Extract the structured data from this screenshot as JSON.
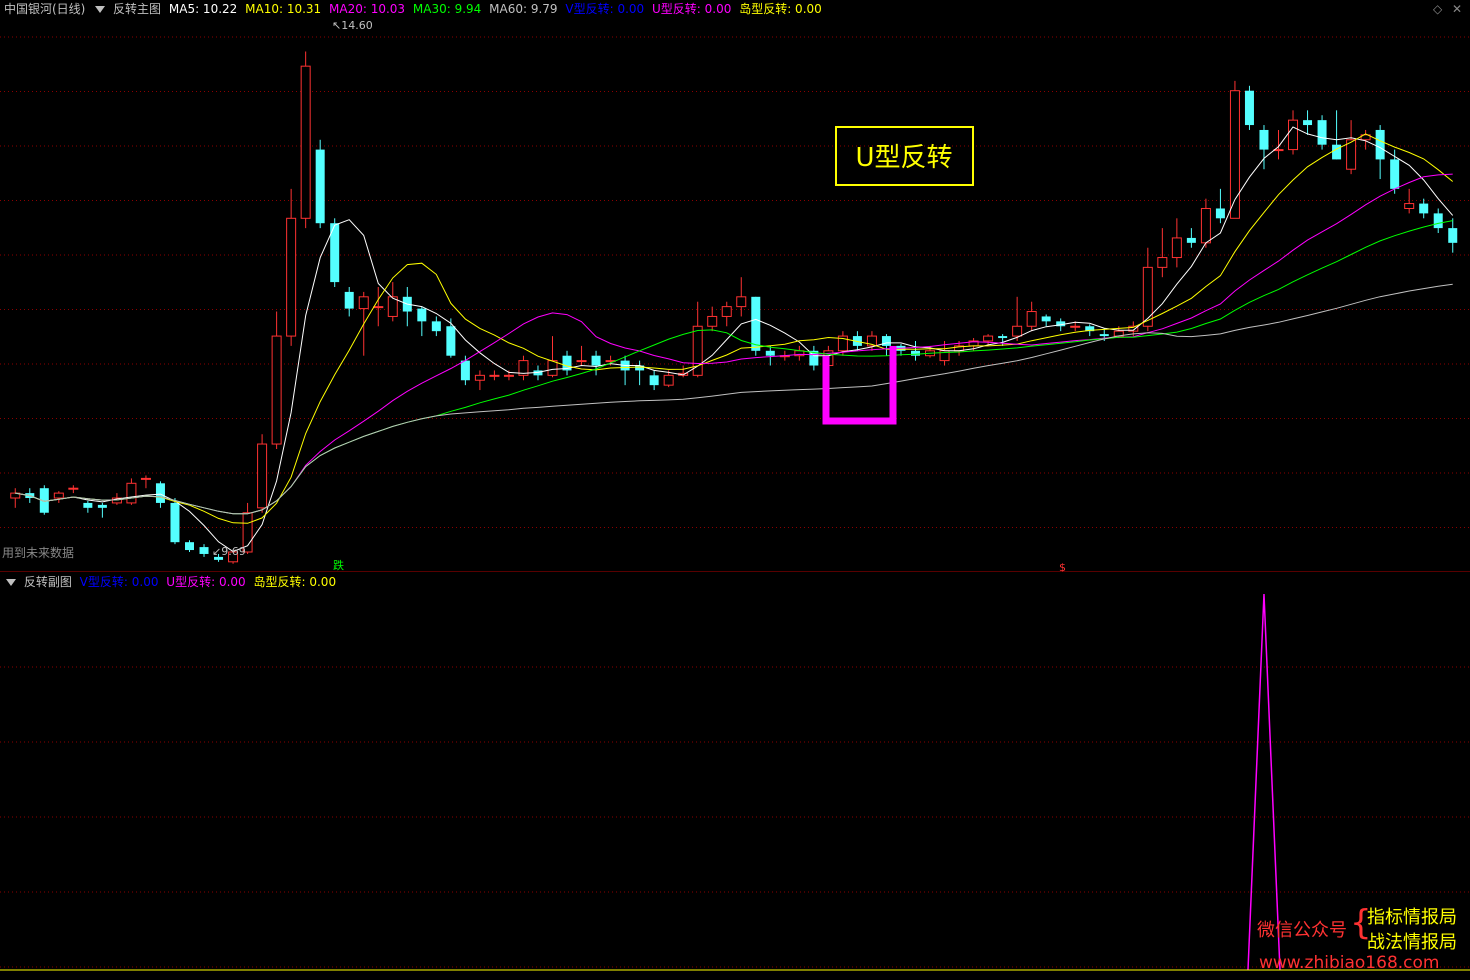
{
  "header": {
    "stock": "中国银河(日线)",
    "indicator": "反转主图",
    "ma": [
      {
        "label": "MA5: 10.22",
        "color": "#ffffff"
      },
      {
        "label": "MA10: 10.31",
        "color": "#ffff00"
      },
      {
        "label": "MA20: 10.03",
        "color": "#ff00ff"
      },
      {
        "label": "MA30: 9.94",
        "color": "#00ff00"
      },
      {
        "label": "MA60: 9.79",
        "color": "#c0c0c0"
      },
      {
        "label": "V型反转: 0.00",
        "color": "#0000ff"
      },
      {
        "label": "U型反转: 0.00",
        "color": "#ff00ff"
      },
      {
        "label": "岛型反转: 0.00",
        "color": "#ffff00"
      }
    ]
  },
  "sub_header": {
    "indicator": "反转副图",
    "items": [
      {
        "label": "V型反转: 0.00",
        "color": "#0000ff"
      },
      {
        "label": "U型反转: 0.00",
        "color": "#ff00ff"
      },
      {
        "label": "岛型反转: 0.00",
        "color": "#ffff00"
      }
    ]
  },
  "labels": {
    "future_data": "用到未来数据",
    "high_price": "14.60",
    "low_price": "9.69",
    "u_box": "U型反转",
    "die": "跌",
    "dollar": "$"
  },
  "watermark": {
    "wechat": "微信公众号",
    "name1": "指标情报局",
    "name2": "战法情报局",
    "url": "www.zhibiao168.com"
  },
  "colors": {
    "up": "#ff3232",
    "down": "#54ffff",
    "ma5": "#ffffff",
    "ma10": "#ffff00",
    "ma20": "#ff00ff",
    "ma30": "#00ff00",
    "ma60": "#c0c0c0",
    "u_mark": "#ff00ff",
    "grid": "#8b0000"
  },
  "chart_data": {
    "type": "candlestick",
    "ylim": [
      9.5,
      14.9
    ],
    "candles": [
      [
        10.05,
        10.1,
        9.95,
        10.15
      ],
      [
        10.1,
        10.05,
        10.0,
        10.15
      ],
      [
        10.15,
        9.9,
        9.88,
        10.18
      ],
      [
        10.05,
        10.1,
        10.0,
        10.12
      ],
      [
        10.15,
        10.15,
        10.1,
        10.18
      ],
      [
        10.0,
        9.95,
        9.9,
        10.02
      ],
      [
        9.98,
        9.95,
        9.85,
        10.0
      ],
      [
        10.0,
        10.05,
        9.98,
        10.1
      ],
      [
        10.0,
        10.2,
        9.98,
        10.25
      ],
      [
        10.25,
        10.25,
        10.15,
        10.28
      ],
      [
        10.2,
        10.0,
        9.95,
        10.22
      ],
      [
        10.0,
        9.6,
        9.58,
        10.05
      ],
      [
        9.6,
        9.52,
        9.5,
        9.62
      ],
      [
        9.55,
        9.48,
        9.45,
        9.58
      ],
      [
        9.45,
        9.42,
        9.4,
        9.48
      ],
      [
        9.4,
        9.5,
        9.38,
        9.52
      ],
      [
        9.5,
        9.9,
        9.48,
        10.0
      ],
      [
        9.95,
        10.6,
        9.9,
        10.7
      ],
      [
        10.6,
        11.7,
        10.55,
        11.95
      ],
      [
        11.7,
        12.9,
        11.6,
        13.2
      ],
      [
        12.9,
        14.45,
        12.8,
        14.6
      ],
      [
        13.6,
        12.85,
        12.8,
        13.7
      ],
      [
        12.85,
        12.25,
        12.2,
        12.9
      ],
      [
        12.15,
        11.98,
        11.9,
        12.2
      ],
      [
        11.98,
        12.1,
        11.5,
        12.15
      ],
      [
        12.0,
        12.0,
        11.8,
        12.2
      ],
      [
        11.9,
        12.1,
        11.85,
        12.25
      ],
      [
        12.1,
        11.95,
        11.8,
        12.2
      ],
      [
        11.98,
        11.85,
        11.7,
        12.0
      ],
      [
        11.85,
        11.75,
        11.7,
        11.9
      ],
      [
        11.8,
        11.5,
        11.48,
        11.88
      ],
      [
        11.45,
        11.25,
        11.2,
        11.5
      ],
      [
        11.25,
        11.3,
        11.15,
        11.35
      ],
      [
        11.3,
        11.3,
        11.25,
        11.35
      ],
      [
        11.3,
        11.3,
        11.25,
        11.35
      ],
      [
        11.3,
        11.45,
        11.25,
        11.5
      ],
      [
        11.35,
        11.3,
        11.25,
        11.4
      ],
      [
        11.3,
        11.45,
        11.28,
        11.7
      ],
      [
        11.5,
        11.35,
        11.3,
        11.55
      ],
      [
        11.45,
        11.45,
        11.4,
        11.6
      ],
      [
        11.5,
        11.4,
        11.3,
        11.55
      ],
      [
        11.45,
        11.45,
        11.4,
        11.5
      ],
      [
        11.45,
        11.35,
        11.2,
        11.5
      ],
      [
        11.4,
        11.35,
        11.2,
        11.45
      ],
      [
        11.3,
        11.2,
        11.15,
        11.35
      ],
      [
        11.2,
        11.3,
        11.18,
        11.35
      ],
      [
        11.3,
        11.32,
        11.28,
        11.4
      ],
      [
        11.3,
        11.8,
        11.28,
        12.05
      ],
      [
        11.8,
        11.9,
        11.75,
        12.0
      ],
      [
        11.9,
        12.0,
        11.8,
        12.05
      ],
      [
        12.0,
        12.1,
        11.9,
        12.3
      ],
      [
        12.1,
        11.55,
        11.5,
        12.1
      ],
      [
        11.55,
        11.5,
        11.4,
        11.6
      ],
      [
        11.5,
        11.5,
        11.45,
        11.55
      ],
      [
        11.5,
        11.55,
        11.45,
        11.6
      ],
      [
        11.55,
        11.4,
        11.35,
        11.6
      ],
      [
        11.4,
        11.55,
        11.38,
        11.6
      ],
      [
        11.55,
        11.7,
        11.5,
        11.75
      ],
      [
        11.7,
        11.6,
        11.55,
        11.75
      ],
      [
        11.6,
        11.7,
        11.55,
        11.75
      ],
      [
        11.7,
        11.6,
        11.5,
        11.72
      ],
      [
        11.6,
        11.55,
        11.5,
        11.62
      ],
      [
        11.55,
        11.5,
        11.45,
        11.65
      ],
      [
        11.5,
        11.55,
        11.48,
        11.6
      ],
      [
        11.45,
        11.55,
        11.4,
        11.65
      ],
      [
        11.55,
        11.6,
        11.5,
        11.65
      ],
      [
        11.6,
        11.65,
        11.55,
        11.68
      ],
      [
        11.65,
        11.7,
        11.6,
        11.72
      ],
      [
        11.7,
        11.68,
        11.6,
        11.72
      ],
      [
        11.7,
        11.8,
        11.65,
        12.1
      ],
      [
        11.8,
        11.95,
        11.75,
        12.05
      ],
      [
        11.9,
        11.85,
        11.8,
        11.92
      ],
      [
        11.85,
        11.8,
        11.75,
        11.88
      ],
      [
        11.8,
        11.8,
        11.75,
        11.85
      ],
      [
        11.8,
        11.75,
        11.7,
        11.82
      ],
      [
        11.72,
        11.7,
        11.65,
        11.78
      ],
      [
        11.7,
        11.75,
        11.68,
        11.8
      ],
      [
        11.75,
        11.8,
        11.7,
        11.85
      ],
      [
        11.8,
        12.4,
        11.75,
        12.6
      ],
      [
        12.4,
        12.5,
        12.3,
        12.8
      ],
      [
        12.5,
        12.7,
        12.4,
        12.9
      ],
      [
        12.7,
        12.65,
        12.6,
        12.8
      ],
      [
        12.65,
        13.0,
        12.6,
        13.1
      ],
      [
        13.0,
        12.9,
        12.85,
        13.2
      ],
      [
        12.9,
        14.2,
        12.9,
        14.3
      ],
      [
        14.2,
        13.85,
        13.8,
        14.25
      ],
      [
        13.8,
        13.6,
        13.4,
        13.85
      ],
      [
        13.6,
        13.6,
        13.5,
        13.8
      ],
      [
        13.6,
        13.9,
        13.55,
        14.0
      ],
      [
        13.9,
        13.85,
        13.75,
        14.0
      ],
      [
        13.9,
        13.65,
        13.6,
        13.95
      ],
      [
        13.65,
        13.5,
        13.5,
        14.0
      ],
      [
        13.4,
        13.7,
        13.35,
        13.9
      ],
      [
        13.7,
        13.75,
        13.6,
        13.8
      ],
      [
        13.8,
        13.5,
        13.3,
        13.85
      ],
      [
        13.5,
        13.2,
        13.15,
        13.6
      ],
      [
        13.0,
        13.05,
        12.95,
        13.2
      ],
      [
        13.05,
        12.95,
        12.9,
        13.1
      ],
      [
        12.95,
        12.8,
        12.75,
        13.0
      ],
      [
        12.8,
        12.65,
        12.55,
        12.9
      ]
    ]
  },
  "sub_chart": {
    "type": "line",
    "ylim": [
      0,
      1
    ],
    "spike_index": 86,
    "values_note": "single U型反转 signal spike"
  }
}
